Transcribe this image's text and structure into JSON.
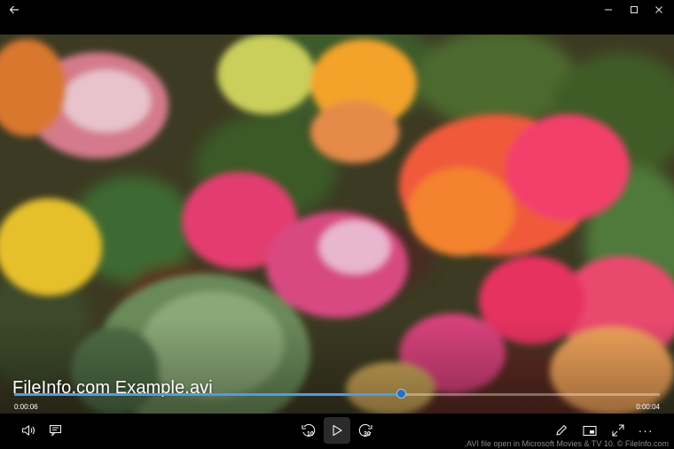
{
  "titlebar": {
    "back_icon": "arrow-left-icon",
    "minimize_glyph": "—",
    "maximize_glyph": "☐",
    "close_glyph": "✕"
  },
  "video": {
    "title": "FileInfo.com Example.avi",
    "elapsed": "0:00:06",
    "remaining": "0:00:04",
    "progress": 0.6,
    "accent_color": "#4f9be8"
  },
  "controls": {
    "volume_icon": "volume-icon",
    "captions_icon": "captions-icon",
    "skip_back_icon": "skip-back-10-icon",
    "skip_back_label": "10",
    "play_icon": "play-icon",
    "skip_forward_icon": "skip-forward-30-icon",
    "skip_forward_label": "30",
    "edit_icon": "pencil-icon",
    "miniplayer_icon": "miniplayer-icon",
    "fullscreen_icon": "fullscreen-icon",
    "more_glyph": "···"
  },
  "watermark": ".AVI file open in Microsoft Movies & TV 10. © FileInfo.com"
}
